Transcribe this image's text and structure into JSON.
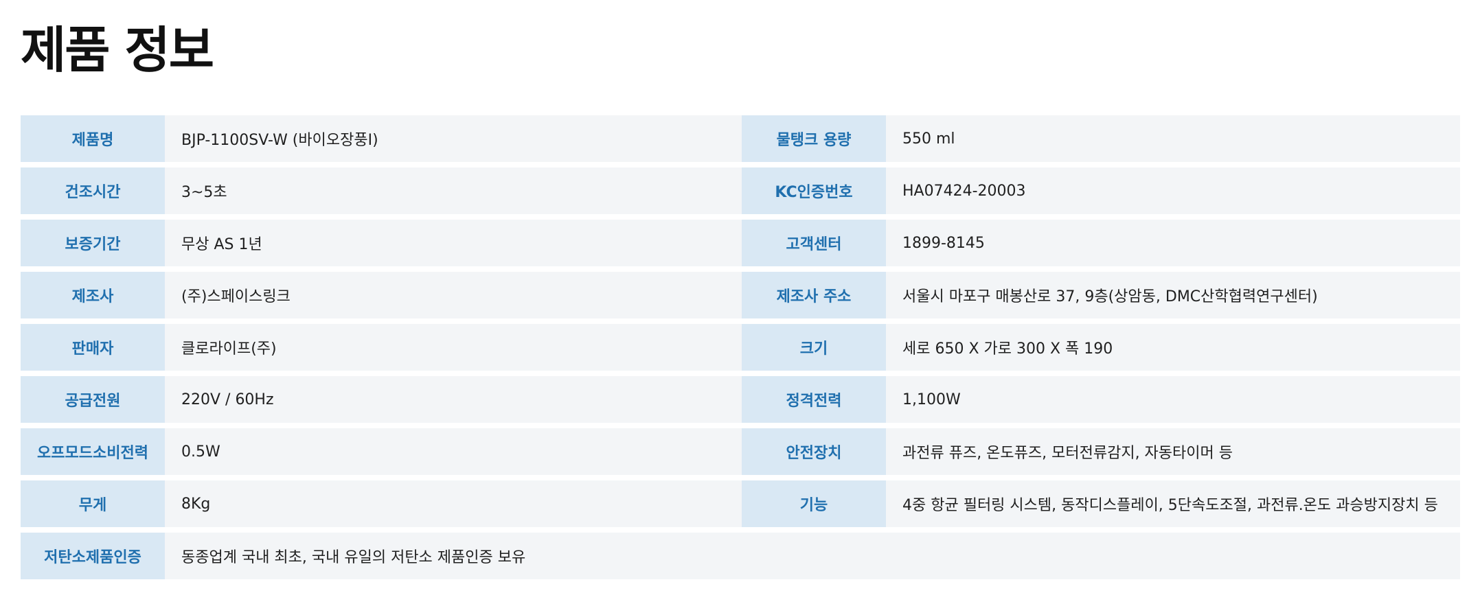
{
  "page": {
    "title": "제품 정보"
  },
  "spec_rows": [
    {
      "left_label": "제품명",
      "left_value": "BJP-1100SV-W (바이오장풍I)",
      "right_label": "물탱크 용량",
      "right_value": "550 ml"
    },
    {
      "left_label": "건조시간",
      "left_value": "3~5초",
      "right_label": "KC인증번호",
      "right_value": "HA07424-20003"
    },
    {
      "left_label": "보증기간",
      "left_value": "무상 AS 1년",
      "right_label": "고객센터",
      "right_value": "1899-8145"
    },
    {
      "left_label": "제조사",
      "left_value": "(주)스페이스링크",
      "right_label": "제조사 주소",
      "right_value": "서울시 마포구 매봉산로 37, 9층(상암동, DMC산학협력연구센터)"
    },
    {
      "left_label": "판매자",
      "left_value": "클로라이프(주)",
      "right_label": "크기",
      "right_value": "세로 650 X 가로 300 X 폭 190"
    },
    {
      "left_label": "공급전원",
      "left_value": "220V / 60Hz",
      "right_label": "정격전력",
      "right_value": "1,100W"
    },
    {
      "left_label": "오프모드소비전력",
      "left_value": "0.5W",
      "right_label": "안전장치",
      "right_value": "과전류 퓨즈, 온도퓨즈, 모터전류감지, 자동타이머 등"
    },
    {
      "left_label": "무게",
      "left_value": "8Kg",
      "right_label": "기능",
      "right_value": "4중 항균 필터링 시스템, 동작디스플레이, 5단속도조절, 과전류.온도 과승방지장치 등"
    },
    {
      "left_label": "저탄소제품인증",
      "left_value": "동종업계 국내 최초, 국내 유일의 저탄소 제품인증 보유"
    }
  ],
  "colors": {
    "label_bg": "#d9e8f4",
    "label_text": "#1f6fae",
    "value_bg": "#f3f5f7",
    "title_text": "#111111"
  }
}
